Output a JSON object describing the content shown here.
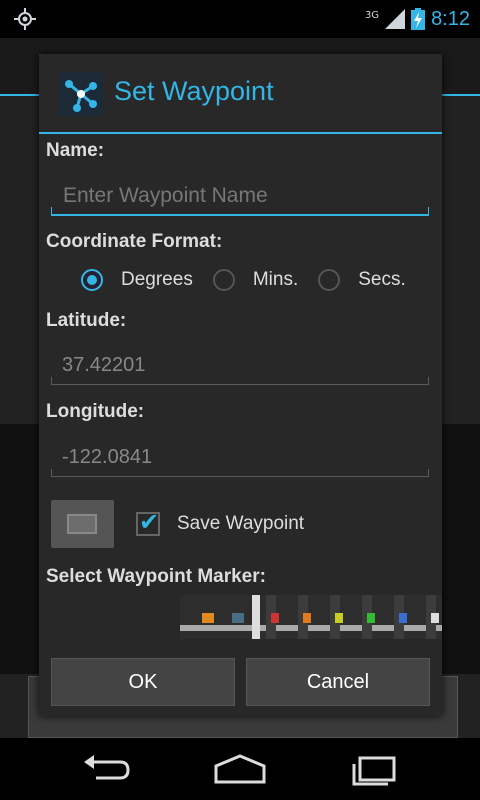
{
  "statusbar": {
    "network": "3G",
    "time": "8:12"
  },
  "dialog": {
    "title": "Set Waypoint",
    "name_label": "Name:",
    "name_placeholder": "Enter Waypoint Name",
    "name_value": "",
    "coord_format_label": "Coordinate Format:",
    "coord_options": [
      {
        "label": "Degrees",
        "checked": true
      },
      {
        "label": "Mins.",
        "checked": false
      },
      {
        "label": "Secs.",
        "checked": false
      }
    ],
    "latitude_label": "Latitude:",
    "latitude_value": "37.42201",
    "longitude_label": "Longitude:",
    "longitude_value": "-122.0841",
    "save_waypoint_label": "Save Waypoint",
    "save_waypoint_checked": true,
    "marker_label": "Select Waypoint Marker:",
    "ok_label": "OK",
    "cancel_label": "Cancel"
  },
  "colors": {
    "accent": "#33b5e5",
    "marker_colors": [
      "#cc3333",
      "#e07b20",
      "#c9cc22",
      "#33bb33",
      "#3a6fd0",
      "#dddddd"
    ]
  },
  "icons": {
    "status_left": "location-crosshair-icon",
    "battery": "battery-charging-icon",
    "nav_back": "back-icon",
    "nav_home": "home-icon",
    "nav_recents": "recent-apps-icon"
  }
}
